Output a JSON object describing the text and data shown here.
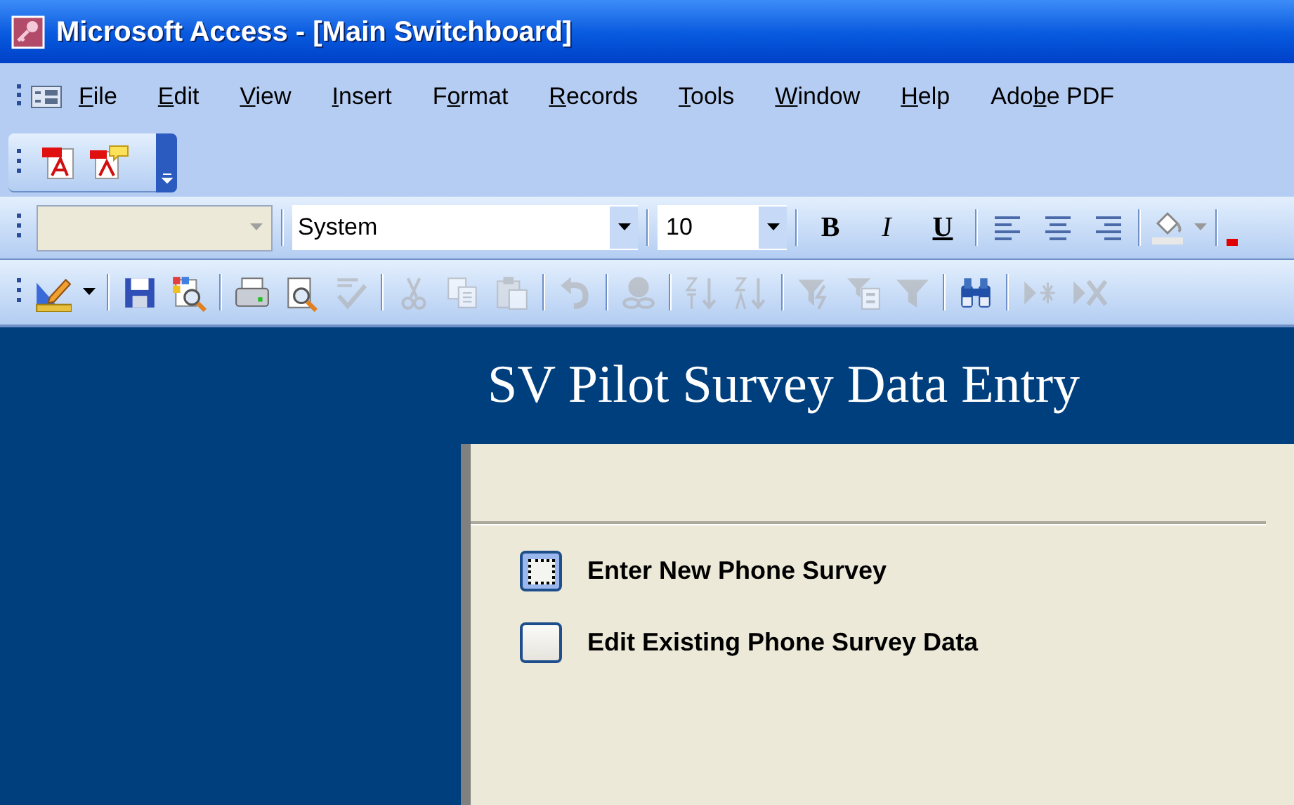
{
  "window": {
    "title": "Microsoft Access - [Main Switchboard]"
  },
  "menu": [
    {
      "key": "F",
      "after": "ile"
    },
    {
      "key": "E",
      "after": "dit"
    },
    {
      "key": "V",
      "after": "iew"
    },
    {
      "key": "I",
      "after": "nsert"
    },
    {
      "before": "F",
      "key": "o",
      "after": "rmat"
    },
    {
      "key": "R",
      "after": "ecords"
    },
    {
      "key": "T",
      "after": "ools"
    },
    {
      "key": "W",
      "after": "indow"
    },
    {
      "key": "H",
      "after": "elp"
    },
    {
      "before": "Ado",
      "key": "b",
      "after": "e PDF"
    }
  ],
  "formatting_toolbar": {
    "object_box": {
      "disabled": true
    },
    "font_box": {
      "value": "System"
    },
    "size_box": {
      "value": "10"
    },
    "style_buttons": [
      "B",
      "I",
      "U"
    ]
  },
  "database_toolbar": [
    {
      "kind": "button",
      "disabled": false
    },
    {
      "kind": "separator"
    },
    {
      "kind": "button",
      "disabled": false
    },
    {
      "kind": "button",
      "disabled": false
    },
    {
      "kind": "separator"
    },
    {
      "kind": "button",
      "disabled": false
    },
    {
      "kind": "button",
      "disabled": false
    },
    {
      "kind": "button",
      "disabled": true
    },
    {
      "kind": "separator"
    },
    {
      "kind": "button",
      "disabled": true
    },
    {
      "kind": "button",
      "disabled": true
    },
    {
      "kind": "button",
      "disabled": true
    },
    {
      "kind": "separator"
    },
    {
      "kind": "button",
      "disabled": true
    },
    {
      "kind": "separator"
    },
    {
      "kind": "button",
      "disabled": true
    },
    {
      "kind": "separator"
    },
    {
      "kind": "button",
      "disabled": true
    },
    {
      "kind": "button",
      "disabled": true
    },
    {
      "kind": "separator"
    },
    {
      "kind": "button",
      "disabled": true
    },
    {
      "kind": "button",
      "disabled": true
    },
    {
      "kind": "button",
      "disabled": true
    },
    {
      "kind": "separator"
    },
    {
      "kind": "button",
      "disabled": false
    },
    {
      "kind": "separator"
    },
    {
      "kind": "button",
      "disabled": true
    },
    {
      "kind": "button",
      "disabled": true
    }
  ],
  "switchboard": {
    "heading": "SV Pilot Survey Data Entry",
    "items": [
      {
        "label": "Enter New Phone Survey",
        "focused": true
      },
      {
        "label": "Edit Existing Phone Survey Data",
        "focused": false
      }
    ]
  }
}
